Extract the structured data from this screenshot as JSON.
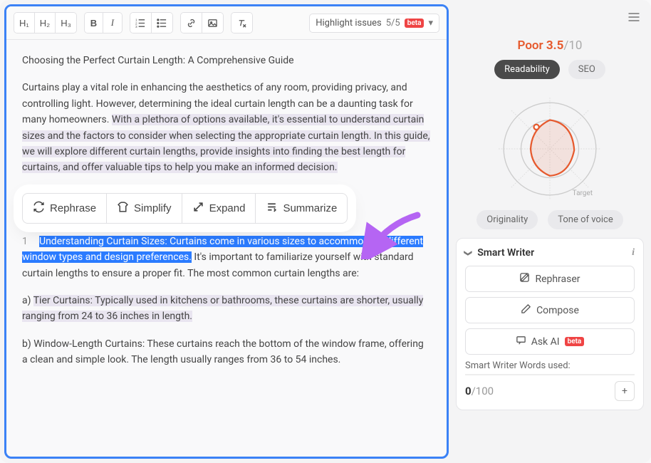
{
  "toolbar": {
    "h1": "H₁",
    "h2": "H₂",
    "h3": "H₃",
    "highlight_issues_label": "Highlight issues",
    "highlight_issues_count": "5/5",
    "beta": "beta"
  },
  "doc": {
    "title": "Choosing the Perfect Curtain Length: A Comprehensive Guide",
    "p1_a": "Curtains play a vital role in enhancing the aesthetics of any room, providing privacy, and controlling light. However, determining the ideal curtain length can be a daunting task for many homeowners. ",
    "p1_b": "With a plethora of options available, it's essential to understand curtain sizes and the factors to consider when selecting the appropriate curtain length.",
    "p1_c": " In this guide, we will explore different curtain lengths, provide insights into finding the best length for curtains, and offer valuable tips to help you make an informed decision.",
    "li1_num": "1",
    "li1_sel": "Understanding Curtain Sizes: Curtains come in various sizes to accommodate different window types and design preferences.",
    "li1_rest": " It's important to familiarize yourself with standard curtain lengths to ensure a proper fit. The most common curtain lengths are:",
    "p3_a": "a) ",
    "p3_b": "Tier Curtains: Typically used in kitchens or bathrooms, these curtains are shorter, usually ranging from 24 to 36 inches in length.",
    "p4": "b) Window-Length Curtains: These curtains reach the bottom of the window frame, offering a clean and simple look. The length usually ranges from 36 to 54 inches."
  },
  "ai": {
    "rephrase": "Rephrase",
    "simplify": "Simplify",
    "expand": "Expand",
    "summarize": "Summarize"
  },
  "score": {
    "label": "Poor",
    "value": "3.5",
    "max": "/10",
    "tab_read": "Readability",
    "tab_seo": "SEO",
    "tab_orig": "Originality",
    "tab_tone": "Tone of voice",
    "target": "Target"
  },
  "smart": {
    "title": "Smart Writer",
    "rephraser": "Rephraser",
    "compose": "Compose",
    "ask_ai": "Ask AI",
    "beta": "beta",
    "words_label": "Smart Writer Words used:",
    "words_val": "0",
    "words_max": "/100"
  }
}
